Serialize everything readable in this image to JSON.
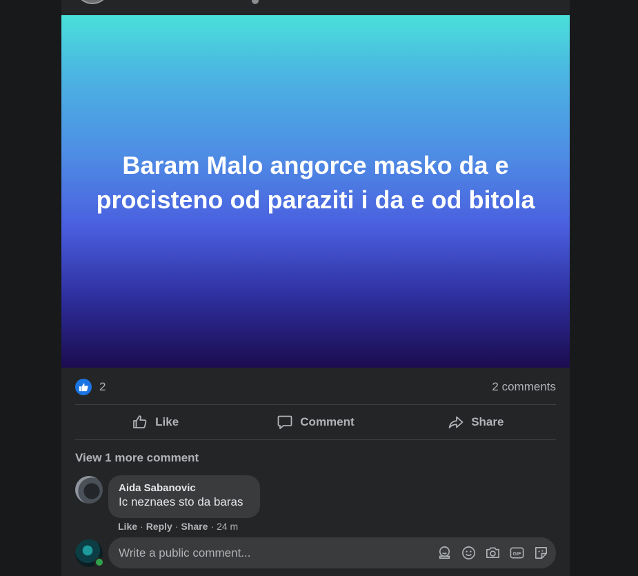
{
  "post": {
    "text": "Baram Malo angorce masko da e procisteno od paraziti i da e od bitola",
    "gradient": [
      "#49e0da",
      "#4e8ce4",
      "#1b0c4f"
    ]
  },
  "stats": {
    "like_count": "2",
    "comments_count": "2 comments"
  },
  "actions": {
    "like": "Like",
    "comment": "Comment",
    "share": "Share"
  },
  "comments": {
    "view_more": "View 1 more comment",
    "items": [
      {
        "author": "Aida Sabanovic",
        "text": "Ic neznaes sto da baras",
        "like": "Like",
        "reply": "Reply",
        "share": "Share",
        "time": "24 m"
      }
    ]
  },
  "composer": {
    "placeholder": "Write a public comment...",
    "icons": [
      "avatar-sticker-icon",
      "emoji-icon",
      "camera-icon",
      "gif-icon",
      "sticker-icon"
    ]
  },
  "colors": {
    "accent": "#1b74e4",
    "online": "#31a24c"
  }
}
